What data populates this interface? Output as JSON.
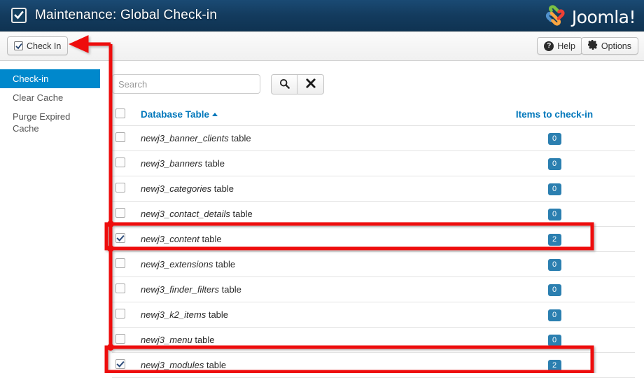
{
  "header": {
    "title": "Maintenance: Global Check-in",
    "title_icon": "checkbox-check-icon",
    "brand": "Joomla!"
  },
  "toolbar": {
    "checkin_label": "Check In",
    "help_label": "Help",
    "options_label": "Options"
  },
  "sidebar": {
    "items": [
      {
        "label": "Check-in",
        "active": true
      },
      {
        "label": "Clear Cache",
        "active": false
      },
      {
        "label": "Purge Expired Cache",
        "active": false
      }
    ]
  },
  "search": {
    "value": "",
    "placeholder": "Search",
    "search_button_icon": "magnifier-icon",
    "clear_button_icon": "cross-icon"
  },
  "table": {
    "columns": {
      "select_all": "select-all-checkbox",
      "name": "Database Table",
      "sort_direction": "ascending",
      "count": "Items to check-in"
    },
    "name_suffix": " table",
    "rows": [
      {
        "name": "newj3_banner_clients",
        "count": "0",
        "checked": false,
        "highlighted": false
      },
      {
        "name": "newj3_banners",
        "count": "0",
        "checked": false,
        "highlighted": false
      },
      {
        "name": "newj3_categories",
        "count": "0",
        "checked": false,
        "highlighted": false
      },
      {
        "name": "newj3_contact_details",
        "count": "0",
        "checked": false,
        "highlighted": false
      },
      {
        "name": "newj3_content",
        "count": "2",
        "checked": true,
        "highlighted": true
      },
      {
        "name": "newj3_extensions",
        "count": "0",
        "checked": false,
        "highlighted": false
      },
      {
        "name": "newj3_finder_filters",
        "count": "0",
        "checked": false,
        "highlighted": false
      },
      {
        "name": "newj3_k2_items",
        "count": "0",
        "checked": false,
        "highlighted": false
      },
      {
        "name": "newj3_menu",
        "count": "0",
        "checked": false,
        "highlighted": false
      },
      {
        "name": "newj3_modules",
        "count": "2",
        "checked": true,
        "highlighted": true
      }
    ]
  },
  "annotation": {
    "color": "#ee1111",
    "arrow_target": "check-in-button"
  },
  "colors": {
    "header_blue": "#153b5e",
    "accent_blue": "#0088cc",
    "link_blue": "#0077bb",
    "badge_blue": "#2b7fb0",
    "annotation_red": "#ee1111"
  }
}
